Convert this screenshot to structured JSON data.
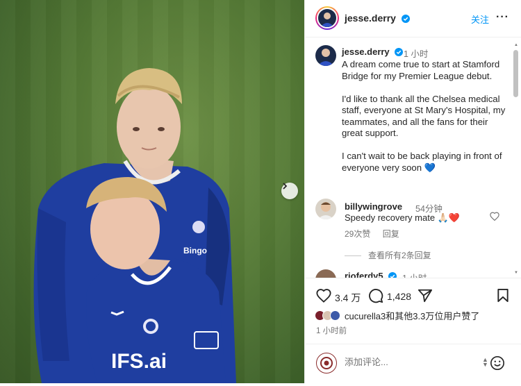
{
  "post": {
    "username": "jesse.derry",
    "follow_label": "关注",
    "more_label": "···"
  },
  "caption": {
    "username": "jesse.derry",
    "time": "1 小时",
    "text": "A dream come true to start at Stamford Bridge for my Premier League debut.\n\nI'd like to thank all the Chelsea medical staff, everyone at St Mary's Hospital, my teammates, and all the fans for their great support.\n\nI can't wait to be back playing in front of everyone very soon 💙"
  },
  "comments": [
    {
      "username": "billywingrove",
      "time": "54分钟",
      "text": "Speedy recovery mate 🙏🏻❤️",
      "likes": "29次赞",
      "reply_label": "回复",
      "view_replies": "查看所有2条回复"
    },
    {
      "username": "rioferdy5",
      "time": "1 小时"
    }
  ],
  "actions": {
    "like_count": "3.4 万",
    "comment_count": "1,428",
    "liked_by": "cucurella3和其他3.3万位用户赞了",
    "post_time": "1 小时前"
  },
  "add_comment": {
    "placeholder": "添加评论..."
  },
  "photo": {
    "shirt_sponsor": "IFS.ai",
    "sleeve_sponsor": "Bingo"
  },
  "colors": {
    "link_blue": "#0095f6",
    "verified_blue": "#0095f6",
    "like_red": "#ed4956",
    "kit_blue": "#1f3ea0"
  },
  "icons": {
    "like": "heart-icon",
    "comment": "comment-icon",
    "share": "send-icon",
    "save": "bookmark-icon",
    "emoji": "emoji-icon",
    "next": "chevron-right-icon"
  }
}
